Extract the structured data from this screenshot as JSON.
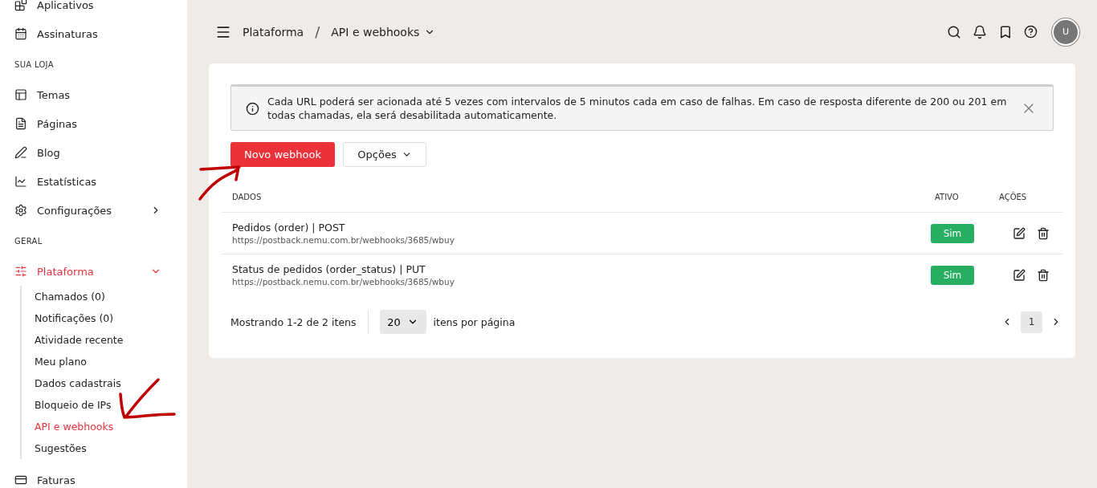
{
  "sidebar": {
    "items": [
      {
        "kind": "link",
        "label": "Aplicativos"
      },
      {
        "kind": "link",
        "label": "Assinaturas"
      },
      {
        "kind": "heading",
        "label": "SUA LOJA"
      },
      {
        "kind": "link",
        "label": "Temas"
      },
      {
        "kind": "link",
        "label": "Páginas"
      },
      {
        "kind": "link",
        "label": "Blog"
      },
      {
        "kind": "link",
        "label": "Estatísticas"
      },
      {
        "kind": "group",
        "label": "Configurações",
        "expanded": false,
        "selected": false
      },
      {
        "kind": "heading",
        "label": "GERAL"
      },
      {
        "kind": "group",
        "label": "Plataforma",
        "expanded": true,
        "selected": true,
        "children": [
          {
            "label": "Chamados (0)",
            "selected": false
          },
          {
            "label": "Notificações (0)",
            "selected": false
          },
          {
            "label": "Atividade recente",
            "selected": false
          },
          {
            "label": "Meu plano",
            "selected": false
          },
          {
            "label": "Dados cadastrais",
            "selected": false
          },
          {
            "label": "Bloqueio de IPs",
            "selected": false
          },
          {
            "label": "API e webhooks",
            "selected": true
          },
          {
            "label": "Sugestões",
            "selected": false
          }
        ]
      },
      {
        "kind": "link",
        "label": "Faturas"
      }
    ]
  },
  "header": {
    "breadcrumb": [
      "Plataforma",
      "API e webhooks"
    ],
    "separator": "/",
    "avatar": "U"
  },
  "alert": {
    "text": "Cada URL poderá ser acionada até 5 vezes com intervalos de 5 minutos cada em caso de falhas. Em caso de resposta diferente de 200 ou 201 em todas chamadas, ela será desabilitada automaticamente."
  },
  "actions": {
    "primary": "Novo webhook",
    "secondary": "Opções"
  },
  "table": {
    "columns": [
      "DADOS",
      "ATIVO",
      "AÇÕES"
    ],
    "rows": [
      {
        "title": "Pedidos (order) | POST",
        "url": "https://postback.nemu.com.br/webhooks/3685/wbuy",
        "active": "Sim"
      },
      {
        "title": "Status de pedidos (order_status) | PUT",
        "url": "https://postback.nemu.com.br/webhooks/3685/wbuy",
        "active": "Sim"
      }
    ]
  },
  "pagination": {
    "summary": "Mostrando 1-2 de 2 itens",
    "page_size": "20",
    "page_size_label": "itens por página",
    "pages": [
      {
        "label": "1",
        "selected": true
      }
    ]
  }
}
